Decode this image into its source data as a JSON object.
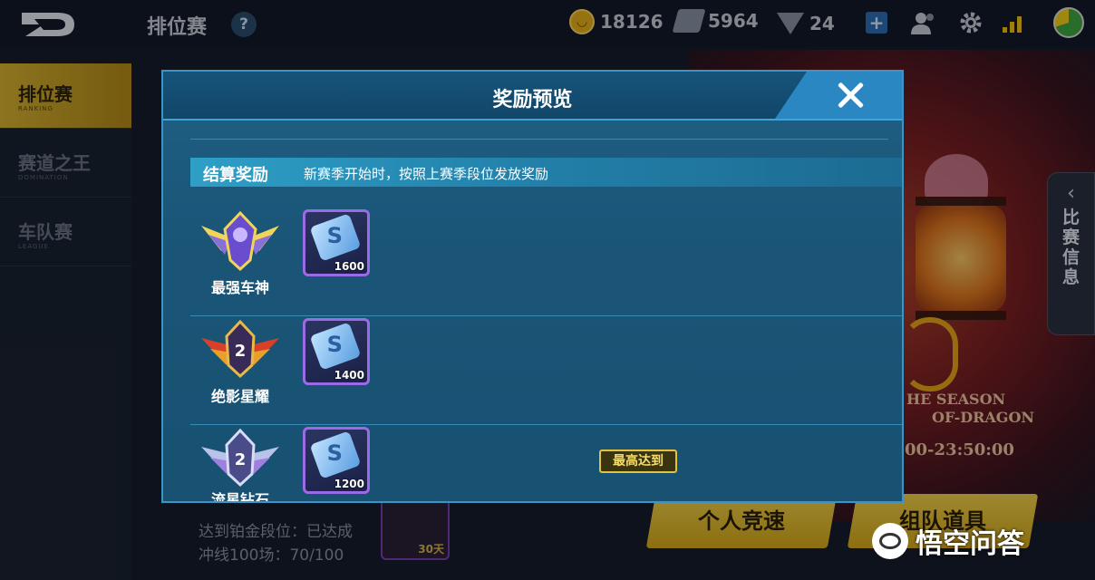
{
  "topbar": {
    "title": "排位赛",
    "help": "?",
    "coins": "18126",
    "tickets": "5964",
    "gems": "24",
    "plus": "+"
  },
  "sidenav": {
    "items": [
      {
        "label": "排位赛",
        "sub": "RANKING",
        "active": true
      },
      {
        "label": "赛道之王",
        "sub": "DOMINATION",
        "active": false
      },
      {
        "label": "车队赛",
        "sub": "LEAGUE",
        "active": false
      }
    ]
  },
  "background": {
    "season_line1": "HE SEASON",
    "season_line2": "OF-DRAGON",
    "season_time": "00-23:50:00",
    "info_tab": "比赛信息",
    "progress_1": "达到铂金段位：已达成",
    "progress_2": "冲线100场：70/100",
    "reward_days": "30天",
    "solo_button": "个人竞速",
    "team_button": "组队道具",
    "watermark": "悟空问答"
  },
  "dialog": {
    "title": "奖励预览",
    "settle_label": "结算奖励",
    "settle_desc": "新赛季开始时，按照上赛季段位发放奖励",
    "tiers": [
      {
        "name": "最强车神",
        "reward_qty": "1600"
      },
      {
        "name": "绝影星耀",
        "reward_qty": "1400"
      },
      {
        "name": "流星钻石",
        "reward_qty": "1200"
      }
    ],
    "highest_badge": "最高达到"
  },
  "colors": {
    "accent_gold": "#e5c23b",
    "dialog_blue": "#1a5577",
    "reward_border": "#9b6ae6"
  }
}
